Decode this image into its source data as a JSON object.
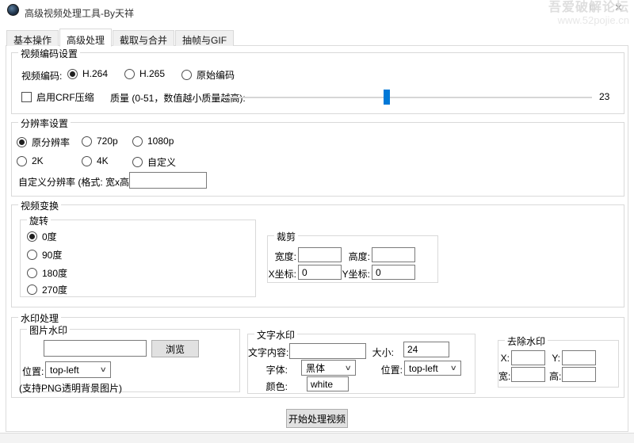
{
  "window": {
    "title": "高级视频处理工具-By天祥",
    "maximize_glyph": "□",
    "close_glyph": "✕",
    "watermark_line1": "吾爱破解论坛",
    "watermark_line2": "www.52pojie.cn"
  },
  "tabs": [
    {
      "label": "基本操作"
    },
    {
      "label": "高级处理"
    },
    {
      "label": "截取与合并"
    },
    {
      "label": "抽帧与GIF"
    }
  ],
  "encoding": {
    "title": "视频编码设置",
    "codec_label": "视频编码:",
    "options": [
      "H.264",
      "H.265",
      "原始编码"
    ],
    "selected_option": "H.264",
    "crf_label": "启用CRF压缩",
    "crf_checked": false,
    "quality_label": "质量 (0-51，数值越小质量越高):",
    "quality_value": "23"
  },
  "resolution": {
    "title": "分辨率设置",
    "options_row1": [
      "原分辨率",
      "720p",
      "1080p"
    ],
    "options_row2": [
      "2K",
      "4K",
      "自定义"
    ],
    "selected_option": "原分辨率",
    "custom_label": "自定义分辨率 (格式: 宽x高):",
    "custom_value": ""
  },
  "transform": {
    "title": "视频变换",
    "rotate": {
      "title": "旋转",
      "options": [
        "0度",
        "90度",
        "180度",
        "270度"
      ],
      "selected_option": "0度"
    },
    "crop": {
      "title": "裁剪",
      "width_label": "宽度:",
      "width_value": "",
      "height_label": "高度:",
      "height_value": "",
      "x_label": "X坐标:",
      "x_value": "0",
      "y_label": "Y坐标:",
      "y_value": "0"
    }
  },
  "watermark": {
    "title": "水印处理",
    "image": {
      "title": "图片水印",
      "path_value": "",
      "browse_label": "浏览",
      "position_label": "位置:",
      "position_value": "top-left",
      "note": "(支持PNG透明背景图片)"
    },
    "text": {
      "title": "文字水印",
      "content_label": "文字内容:",
      "content_value": "",
      "size_label": "大小:",
      "size_value": "24",
      "font_label": "字体:",
      "font_value": "黑体",
      "position_label": "位置:",
      "position_value": "top-left",
      "color_label": "颜色:",
      "color_value": "white"
    },
    "remove": {
      "title": "去除水印",
      "x_label": "X:",
      "x_value": "",
      "y_label": "Y:",
      "y_value": "",
      "w_label": "宽:",
      "w_value": "",
      "h_label": "高:",
      "h_value": ""
    }
  },
  "footer": {
    "process_button": "开始处理视频"
  },
  "colors": {
    "accent": "#0078d7",
    "tab_inactive_bg": "#f0f0f0",
    "groupbox_border": "#d9d9d9"
  }
}
